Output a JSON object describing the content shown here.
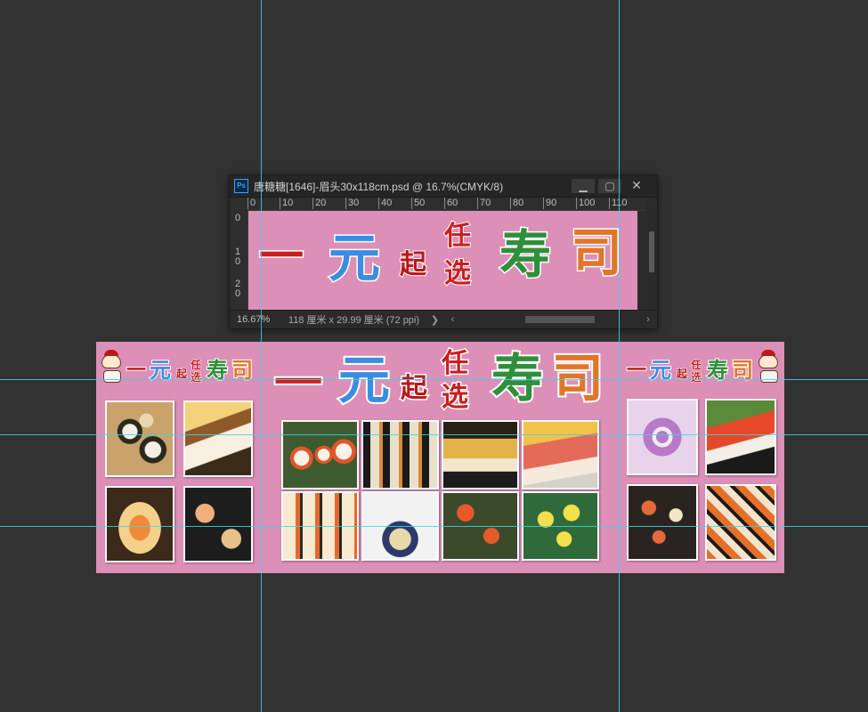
{
  "document_window": {
    "app_icon_label": "Ps",
    "title": "唐糖糖[1646]-眉头30x118cm.psd @ 16.7%(CMYK/8)",
    "controls": {
      "minimize": "▁",
      "maximize": "▢",
      "close": "✕"
    },
    "ruler_horizontal": [
      "0",
      "10",
      "20",
      "30",
      "40",
      "50",
      "60",
      "70",
      "80",
      "90",
      "100",
      "110"
    ],
    "ruler_vertical": [
      "0",
      "1\n0",
      "2\n0"
    ],
    "status": {
      "zoom": "16.67%",
      "dimensions": "118 厘米 x 29.99 厘米 (72 ppi)",
      "nav_right": "❯",
      "scroll_left": "‹",
      "scroll_right": "›"
    }
  },
  "banner": {
    "headline": {
      "one": "一",
      "yuan": "元",
      "qi": "起",
      "ren": "任",
      "xuan": "选",
      "shou": "寿",
      "si": "司"
    },
    "colors": {
      "background": "#dc8fb7",
      "red": "#c8201e",
      "blue": "#3a8de0",
      "green": "#2f8f3a",
      "orange": "#e0762a",
      "guide": "#38d6e6"
    }
  }
}
